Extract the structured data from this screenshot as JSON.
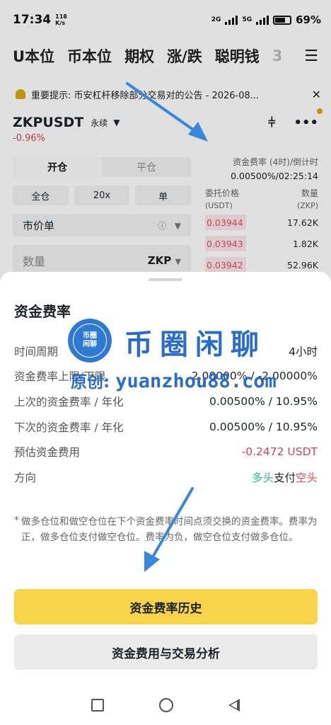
{
  "status_bar": {
    "time": "17:34",
    "net_speed_value": "118",
    "net_speed_unit": "K/s",
    "signal_1": "2G",
    "signal_2": "5G",
    "battery": "69%"
  },
  "top_tabs": [
    "U本位",
    "币本位",
    "期权",
    "涨/跌",
    "聪明钱",
    "3"
  ],
  "notice": {
    "text": "重要提示: 币安杠杆移除部分交易对的公告 - 2026-08..."
  },
  "pair": {
    "symbol": "ZKPUSDT",
    "type": "永续",
    "change": "-0.96%"
  },
  "order_form": {
    "tabs": [
      "开仓",
      "平仓"
    ],
    "margin_mode": "全仓",
    "leverage": "20x",
    "position_mode": "单",
    "order_type": "市价单",
    "qty_placeholder": "数量",
    "qty_unit": "ZKP"
  },
  "funding_header": {
    "label": "资金费率 (4时)/倒计时",
    "value": "0.00500%/02:25:14"
  },
  "orderbook": {
    "price_header": "委托价格",
    "qty_header": "数量",
    "price_unit": "(USDT)",
    "qty_unit": "(ZKP)",
    "rows": [
      {
        "price": "0.03944",
        "qty": "17.62K"
      },
      {
        "price": "0.03943",
        "qty": "1.82K"
      },
      {
        "price": "0.03942",
        "qty": "52.96K"
      }
    ]
  },
  "sheet": {
    "title": "资金费率",
    "rows": [
      {
        "label": "时间周期",
        "value": "4小时"
      },
      {
        "label": "资金费率上限/下限",
        "value": "2.00000% / -2.00000%"
      },
      {
        "label": "上次的资金费率 / 年化",
        "value": "0.00500% / 10.95%"
      },
      {
        "label": "下次的资金费率 / 年化",
        "value": "0.00500% / 10.95%"
      },
      {
        "label": "预估资金费用",
        "value": "-0.2472 USDT"
      }
    ],
    "direction": {
      "label": "方向",
      "long": "多头",
      "pays": "支付",
      "short": "空头"
    },
    "footnote_mark": "*",
    "footnote": "做多仓位和做空仓位在下个资金费率时间点须交换的资金费率。费率为正，做多仓位支付做空仓位。费率为负，做空仓位支付做多仓位。",
    "primary_button": "资金费率历史",
    "secondary_button": "资金费用与交易分析"
  },
  "watermark": {
    "badge_line1": "币圈",
    "badge_line2": "闲聊",
    "title": "币圈闲聊",
    "credit_prefix": "原创:",
    "credit_url": "yuanzhou88.com"
  },
  "colors": {
    "accent_yellow": "#f7d44a",
    "negative_red": "#c8455a",
    "long_green": "#2ebd85",
    "short_red": "#f6465d",
    "annotation_blue": "#3a86dc"
  }
}
